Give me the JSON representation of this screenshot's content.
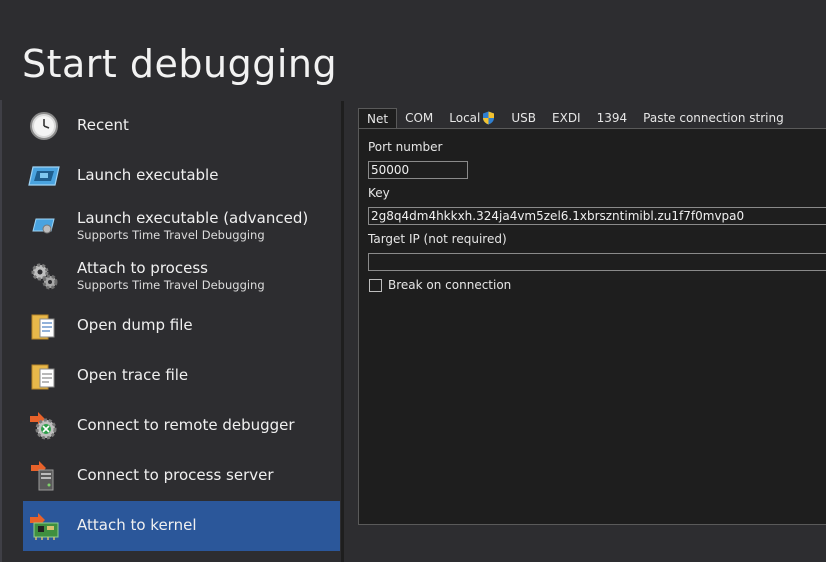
{
  "title": "Start debugging",
  "nav": {
    "items": [
      {
        "label": "Recent",
        "icon": "clock-icon"
      },
      {
        "label": "Launch executable",
        "icon": "window-app-icon"
      },
      {
        "label": "Launch executable (advanced)",
        "sub": "Supports Time Travel Debugging",
        "icon": "window-app-advanced-icon"
      },
      {
        "label": "Attach to process",
        "sub": "Supports Time Travel Debugging",
        "icon": "gears-icon"
      },
      {
        "label": "Open dump file",
        "icon": "folder-document-icon"
      },
      {
        "label": "Open trace file",
        "icon": "folder-trace-icon"
      },
      {
        "label": "Connect to remote debugger",
        "icon": "remote-gear-icon"
      },
      {
        "label": "Connect to process server",
        "icon": "server-icon"
      },
      {
        "label": "Attach to kernel",
        "icon": "circuit-board-icon",
        "selected": true
      }
    ]
  },
  "tabs": [
    {
      "label": "Net",
      "active": true
    },
    {
      "label": "COM"
    },
    {
      "label": "Local",
      "icon": "uac-shield-icon"
    },
    {
      "label": "USB"
    },
    {
      "label": "EXDI"
    },
    {
      "label": "1394"
    },
    {
      "label": "Paste connection string"
    }
  ],
  "form": {
    "port_label": "Port number",
    "port_value": "50000",
    "key_label": "Key",
    "key_value": "2g8q4dm4hkkxh.324ja4vm5zel6.1xbrszntimibl.zu1f7f0mvpa0",
    "ip_label": "Target IP (not required)",
    "ip_value": "",
    "break_label": "Break on connection",
    "break_checked": false
  },
  "colors": {
    "background": "#2d2d30",
    "selected": "#2b579a",
    "panel": "#1e1e1e"
  }
}
